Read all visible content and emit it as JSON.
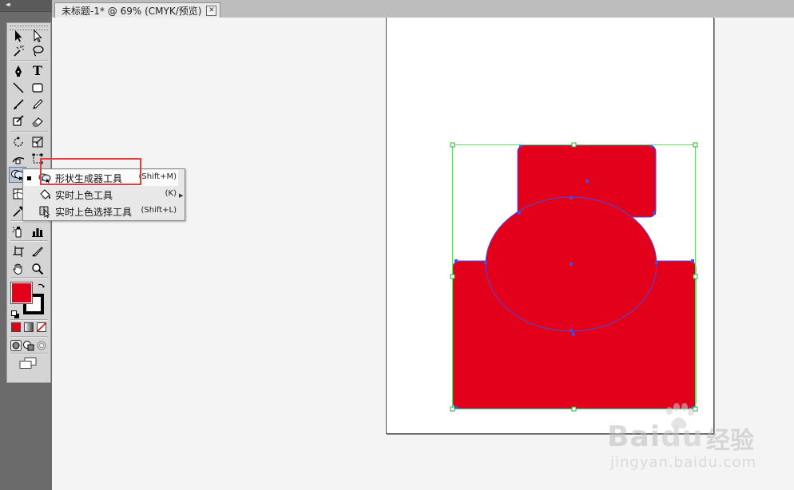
{
  "document_tab": {
    "title": "未标题-1* @ 69% (CMYK/预览)",
    "close_glyph": "✕"
  },
  "toolbar": {
    "collapse_glyph": "◂◂",
    "tools": [
      {
        "name": "selection-tool-icon"
      },
      {
        "name": "direct-selection-tool-icon"
      },
      {
        "name": "magic-wand-tool-icon"
      },
      {
        "name": "lasso-tool-icon"
      },
      {
        "name": "pen-tool-icon"
      },
      {
        "name": "type-tool-icon",
        "glyph": "T"
      },
      {
        "name": "line-segment-tool-icon"
      },
      {
        "name": "rectangle-tool-icon"
      },
      {
        "name": "paintbrush-tool-icon"
      },
      {
        "name": "pencil-tool-icon"
      },
      {
        "name": "blob-brush-tool-icon"
      },
      {
        "name": "eraser-tool-icon"
      },
      {
        "name": "rotate-tool-icon"
      },
      {
        "name": "scale-tool-icon"
      },
      {
        "name": "width-tool-icon"
      },
      {
        "name": "free-transform-tool-icon"
      },
      {
        "name": "shape-builder-tool-icon"
      },
      {
        "name": "perspective-grid-tool-icon"
      },
      {
        "name": "eyedropper-tool-icon"
      },
      {
        "name": "symbol-sprayer-tool-icon"
      },
      {
        "name": "column-graph-tool-icon"
      },
      {
        "name": "artboard-tool-icon"
      },
      {
        "name": "slice-tool-icon"
      },
      {
        "name": "hand-tool-icon"
      },
      {
        "name": "zoom-tool-icon"
      }
    ],
    "fill_color": "#e2001a",
    "stroke_color": "#000000"
  },
  "flyout": {
    "items": [
      {
        "label": "形状生成器工具",
        "shortcut": "(Shift+M)",
        "selected": true
      },
      {
        "label": "实时上色工具",
        "shortcut": "(K)",
        "selected": false
      },
      {
        "label": "实时上色选择工具",
        "shortcut": "(Shift+L)",
        "selected": false
      }
    ],
    "highlight_color": "#e43b3b"
  },
  "artwork": {
    "shape_fill": "#e2001a",
    "path_color": "#4a4ae0",
    "bbox_color": "#5fdc5f"
  },
  "watermark": {
    "brand": "Bai",
    "brand2": "du",
    "suffix": "经验",
    "url": "jingyan.baidu.com"
  }
}
